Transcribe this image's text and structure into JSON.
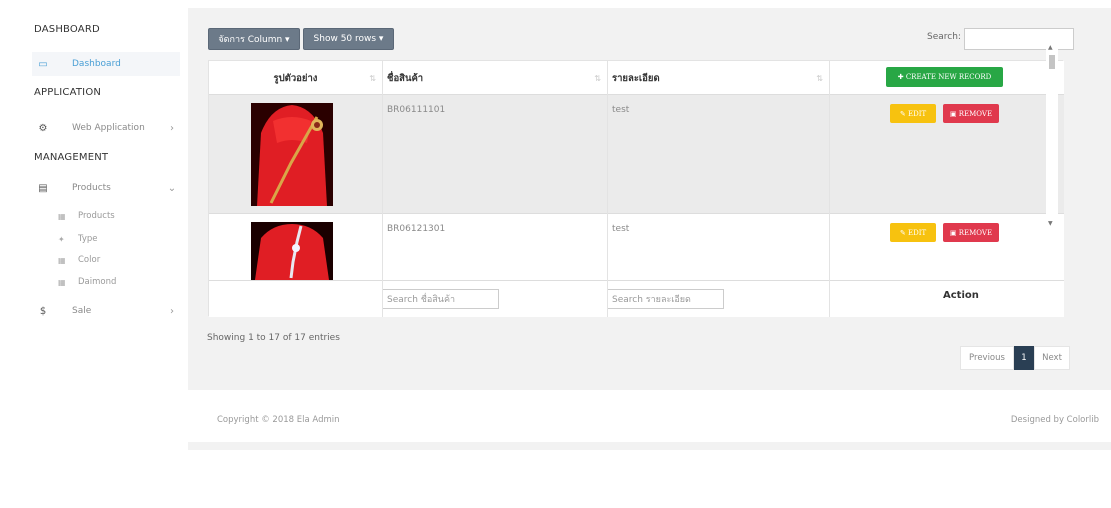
{
  "sidebar": {
    "sections": [
      {
        "heading": "DASHBOARD"
      },
      {
        "heading": "APPLICATION"
      },
      {
        "heading": "MANAGEMENT"
      }
    ],
    "items": [
      {
        "label": "Dashboard",
        "icon": "monitor-icon",
        "active": true
      },
      {
        "label": "Web Application",
        "icon": "gears-icon",
        "arrow": ">"
      },
      {
        "label": "Products",
        "icon": "table-icon",
        "arrow": "v"
      },
      {
        "label": "Sale",
        "icon": "dollar-icon",
        "arrow": ">"
      }
    ],
    "subitems": [
      {
        "label": "Products"
      },
      {
        "label": "Type"
      },
      {
        "label": "Color"
      },
      {
        "label": "Daimond"
      }
    ]
  },
  "toolbar": {
    "column_button": "จัดการ Column ▾",
    "rows_button": "Show 50 rows ▾",
    "search_label": "Search:"
  },
  "table": {
    "headers": [
      "รูปตัวอย่าง",
      "ชื่อสินค้า",
      "รายละเอียด"
    ],
    "create_button": "✚ CREATE NEW RECORD",
    "rows": [
      {
        "code": "BR06111101",
        "detail": "test"
      },
      {
        "code": "BR06121301",
        "detail": "test"
      }
    ],
    "edit_label": "✎ EDIT",
    "remove_label": "▣ REMOVE",
    "footer": {
      "search_name_placeholder": "Search ชื่อสินค้า",
      "search_detail_placeholder": "Search รายละเอียด",
      "action_label": "Action"
    }
  },
  "table_info": "Showing 1 to 17 of 17 entries",
  "pagination": {
    "previous": "Previous",
    "current": "1",
    "next": "Next"
  },
  "footer": {
    "copyright": "Copyright © 2018 Ela Admin",
    "designed_by": "Designed by Colorlib"
  },
  "colors": {
    "create": "#28a745",
    "edit": "#f7c20f",
    "remove": "#e0394d",
    "page_current": "#2a3f54",
    "product_red": "#e01e24"
  }
}
